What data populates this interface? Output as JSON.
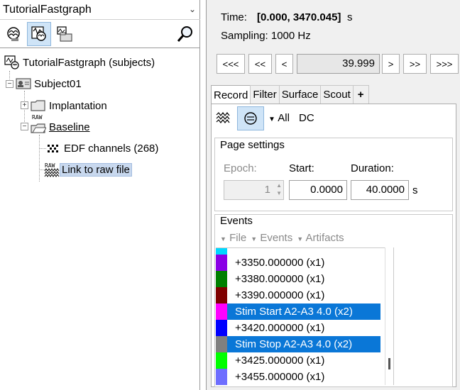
{
  "protocol_selector": {
    "value": "TutorialFastgraph"
  },
  "tree": {
    "root": "TutorialFastgraph (subjects)",
    "subject": "Subject01",
    "implantation": "Implantation",
    "baseline": "Baseline",
    "edf_channels": "EDF channels (268)",
    "link_raw": "Link to raw file",
    "raw_tag": "RAW"
  },
  "record": {
    "time_label": "Time:",
    "time_range": "[0.000, 3470.045]",
    "time_unit": "s",
    "sampling": "Sampling: 1000 Hz",
    "nav": [
      "<<<",
      "<<",
      "<",
      ">",
      ">>",
      ">>>"
    ],
    "current_time": "39.999"
  },
  "tabs": [
    "Record",
    "Filter",
    "Surface",
    "Scout",
    "+"
  ],
  "toolbar": {
    "all_label": "All",
    "dc_label": "DC"
  },
  "page_settings": {
    "title": "Page settings",
    "epoch_label": "Epoch:",
    "epoch_value": "1",
    "start_label": "Start:",
    "start_value": "0.0000",
    "duration_label": "Duration:",
    "duration_value": "40.0000",
    "duration_unit": "s"
  },
  "events": {
    "title": "Events",
    "menus": [
      "File",
      "Events",
      "Artifacts"
    ],
    "items": [
      {
        "label": "",
        "color": "#00d8ff",
        "selected": false
      },
      {
        "label": "+3350.000000  (x1)",
        "color": "#8a00e6",
        "selected": false
      },
      {
        "label": "+3380.000000  (x1)",
        "color": "#007f00",
        "selected": false
      },
      {
        "label": "+3390.000000  (x1)",
        "color": "#7f0000",
        "selected": false
      },
      {
        "label": "Stim Start A2-A3 4.0  (x2)",
        "color": "#ff00ff",
        "selected": true
      },
      {
        "label": "+3420.000000  (x1)",
        "color": "#0000ff",
        "selected": false
      },
      {
        "label": "Stim Stop A2-A3 4.0  (x2)",
        "color": "#808080",
        "selected": true
      },
      {
        "label": "+3425.000000  (x1)",
        "color": "#00ff00",
        "selected": false
      },
      {
        "label": "+3455.000000  (x1)",
        "color": "#6e6eff",
        "selected": false
      }
    ]
  }
}
